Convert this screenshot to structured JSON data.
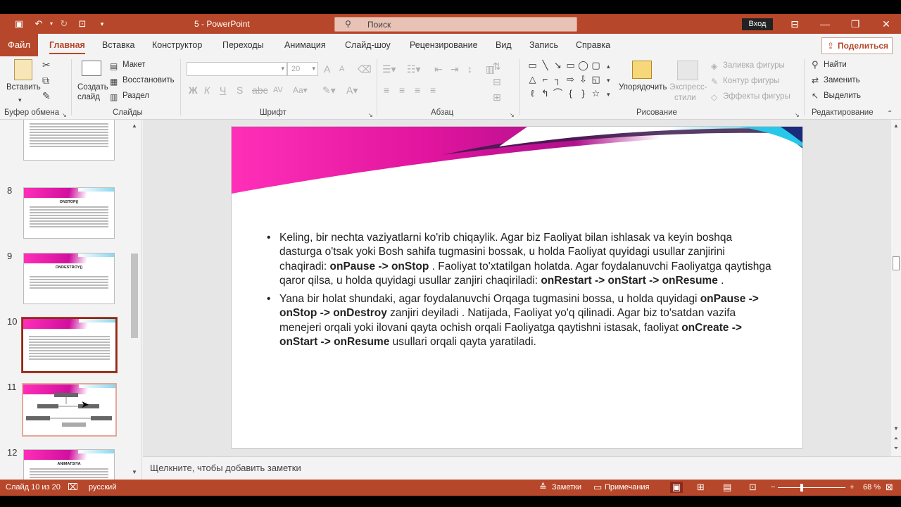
{
  "app": {
    "title": "5  -  PowerPoint",
    "search_placeholder": "Поиск",
    "login": "Вход",
    "share": "Поделиться"
  },
  "tabs": [
    "Файл",
    "Главная",
    "Вставка",
    "Конструктор",
    "Переходы",
    "Анимация",
    "Слайд-шоу",
    "Рецензирование",
    "Вид",
    "Запись",
    "Справка"
  ],
  "active_tab": "Главная",
  "ribbon": {
    "clipboard": {
      "label": "Буфер обмена",
      "paste": "Вставить"
    },
    "slides": {
      "label": "Слайды",
      "new_slide": "Создать",
      "new_slide2": "слайд",
      "layout": "Макет",
      "reset": "Восстановить",
      "section": "Раздел"
    },
    "font": {
      "label": "Шрифт",
      "size": "20"
    },
    "paragraph": {
      "label": "Абзац"
    },
    "drawing": {
      "label": "Рисование",
      "arrange": "Упорядочить",
      "quick_styles": "Экспресс-",
      "quick_styles2": "стили",
      "fill": "Заливка фигуры",
      "outline": "Контур фигуры",
      "effects": "Эффекты фигуры"
    },
    "editing": {
      "label": "Редактирование",
      "find": "Найти",
      "replace": "Заменить",
      "select": "Выделить"
    }
  },
  "thumbnails": [
    {
      "num": "8",
      "title": "ONSTOP()"
    },
    {
      "num": "9",
      "title": "ONDESTROY()"
    },
    {
      "num": "10",
      "title": ""
    },
    {
      "num": "11",
      "title": ""
    },
    {
      "num": "12",
      "title": "ANIMATSIYA"
    }
  ],
  "slide": {
    "bullet1": {
      "t1": "Keling, bir nechta vaziyatlarni ko'rib chiqaylik. Agar biz Faoliyat bilan ishlasak va keyin boshqa dasturga o'tsak yoki Bosh sahifa tugmasini bossak, u holda Faoliyat quyidagi usullar zanjirini chaqiradi: ",
      "b1": "onPause -> onStop",
      "t2": " . Faoliyat to'xtatilgan holatda. Agar foydalanuvchi Faoliyatga qaytishga qaror qilsa, u holda quyidagi usullar zanjiri chaqiriladi: ",
      "b2": "onRestart -> onStart -> onResume",
      "t3": " ."
    },
    "bullet2": {
      "t1": "Yana bir holat shundaki, agar foydalanuvchi Orqaga tugmasini bossa, u holda quyidagi ",
      "b1": "onPause -> onStop -> onDestroy",
      "t2": " zanjiri deyiladi . Natijada, Faoliyat yo'q qilinadi. Agar biz to'satdan vazifa menejeri orqali yoki ilovani qayta ochish orqali Faoliyatga qaytishni istasak, faoliyat ",
      "b2": "onCreate -> onStart -> onResume",
      "t3": " usullari orqali qayta yaratiladi."
    }
  },
  "notes_placeholder": "Щелкните, чтобы добавить заметки",
  "status": {
    "slide_info": "Слайд 10 из 20",
    "language": "русский",
    "notes": "Заметки",
    "comments": "Примечания",
    "zoom": "68 %"
  },
  "colors": {
    "accent": "#b7472a",
    "slide_gradient_pink": "#ff2fb8",
    "slide_gradient_cyan": "#27c7ea"
  }
}
